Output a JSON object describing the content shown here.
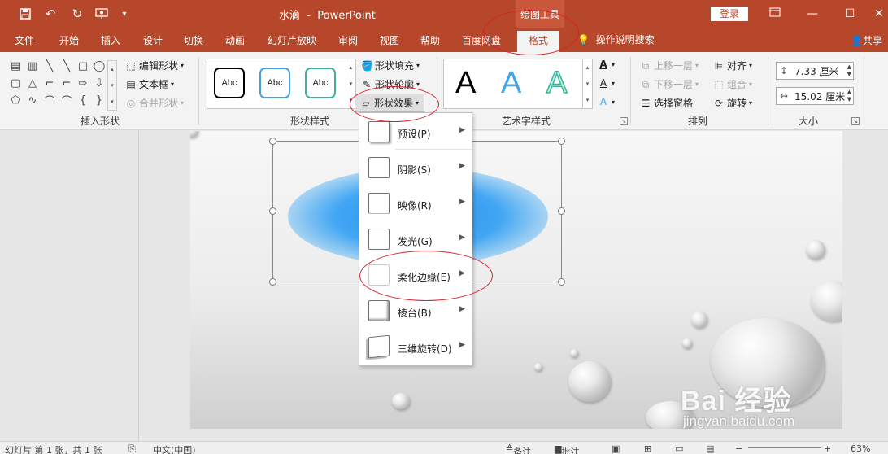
{
  "titlebar": {
    "doc_name": "水滴",
    "separator": "-",
    "app_name": "PowerPoint",
    "context_group": "绘图工具",
    "login": "登录",
    "quick_access": [
      "save-icon",
      "undo-icon",
      "redo-icon",
      "present-icon",
      "customize-icon"
    ],
    "window_controls": [
      "ribbon-display-icon",
      "minimize-icon",
      "maximize-icon",
      "close-icon"
    ]
  },
  "tabs": [
    "文件",
    "开始",
    "插入",
    "设计",
    "切换",
    "动画",
    "幻灯片放映",
    "审阅",
    "视图",
    "帮助",
    "百度网盘",
    "格式"
  ],
  "active_tab": "格式",
  "tell_me": "操作说明搜索",
  "share": "共享",
  "ribbon": {
    "insert_shapes": {
      "label": "插入形状",
      "edit_shape": "编辑形状",
      "text_box": "文本框",
      "merge_shapes": "合并形状"
    },
    "shape_styles": {
      "label": "形状样式",
      "samples": [
        "Abc",
        "Abc",
        "Abc"
      ],
      "fill": "形状填充",
      "outline": "形状轮廓",
      "effects": "形状效果"
    },
    "wordart": {
      "label": "艺术字样式",
      "letters": [
        "A",
        "A",
        "A"
      ]
    },
    "arrange": {
      "label": "排列",
      "bring_forward": "上移一层",
      "send_backward": "下移一层",
      "selection_pane": "选择窗格",
      "align": "对齐",
      "group": "组合",
      "rotate": "旋转"
    },
    "size": {
      "label": "大小",
      "height": "7.33 厘米",
      "width": "15.02 厘米"
    }
  },
  "effects_menu": [
    {
      "label": "预设(P)"
    },
    {
      "label": "阴影(S)"
    },
    {
      "label": "映像(R)"
    },
    {
      "label": "发光(G)"
    },
    {
      "label": "柔化边缘(E)"
    },
    {
      "label": "棱台(B)"
    },
    {
      "label": "三维旋转(D)"
    }
  ],
  "watermark": {
    "brand": "Bai 经验",
    "url": "jingyan.baidu.com"
  },
  "statusbar": {
    "slide_info": "幻灯片 第 1 张，共 1 张",
    "language": "中文(中国)",
    "notes": "备注",
    "comments": "批注",
    "zoom": "63%"
  },
  "colors": {
    "accent": "#b7472a",
    "annotation": "#d4202a",
    "shape_fill": "#2a8fe8"
  }
}
